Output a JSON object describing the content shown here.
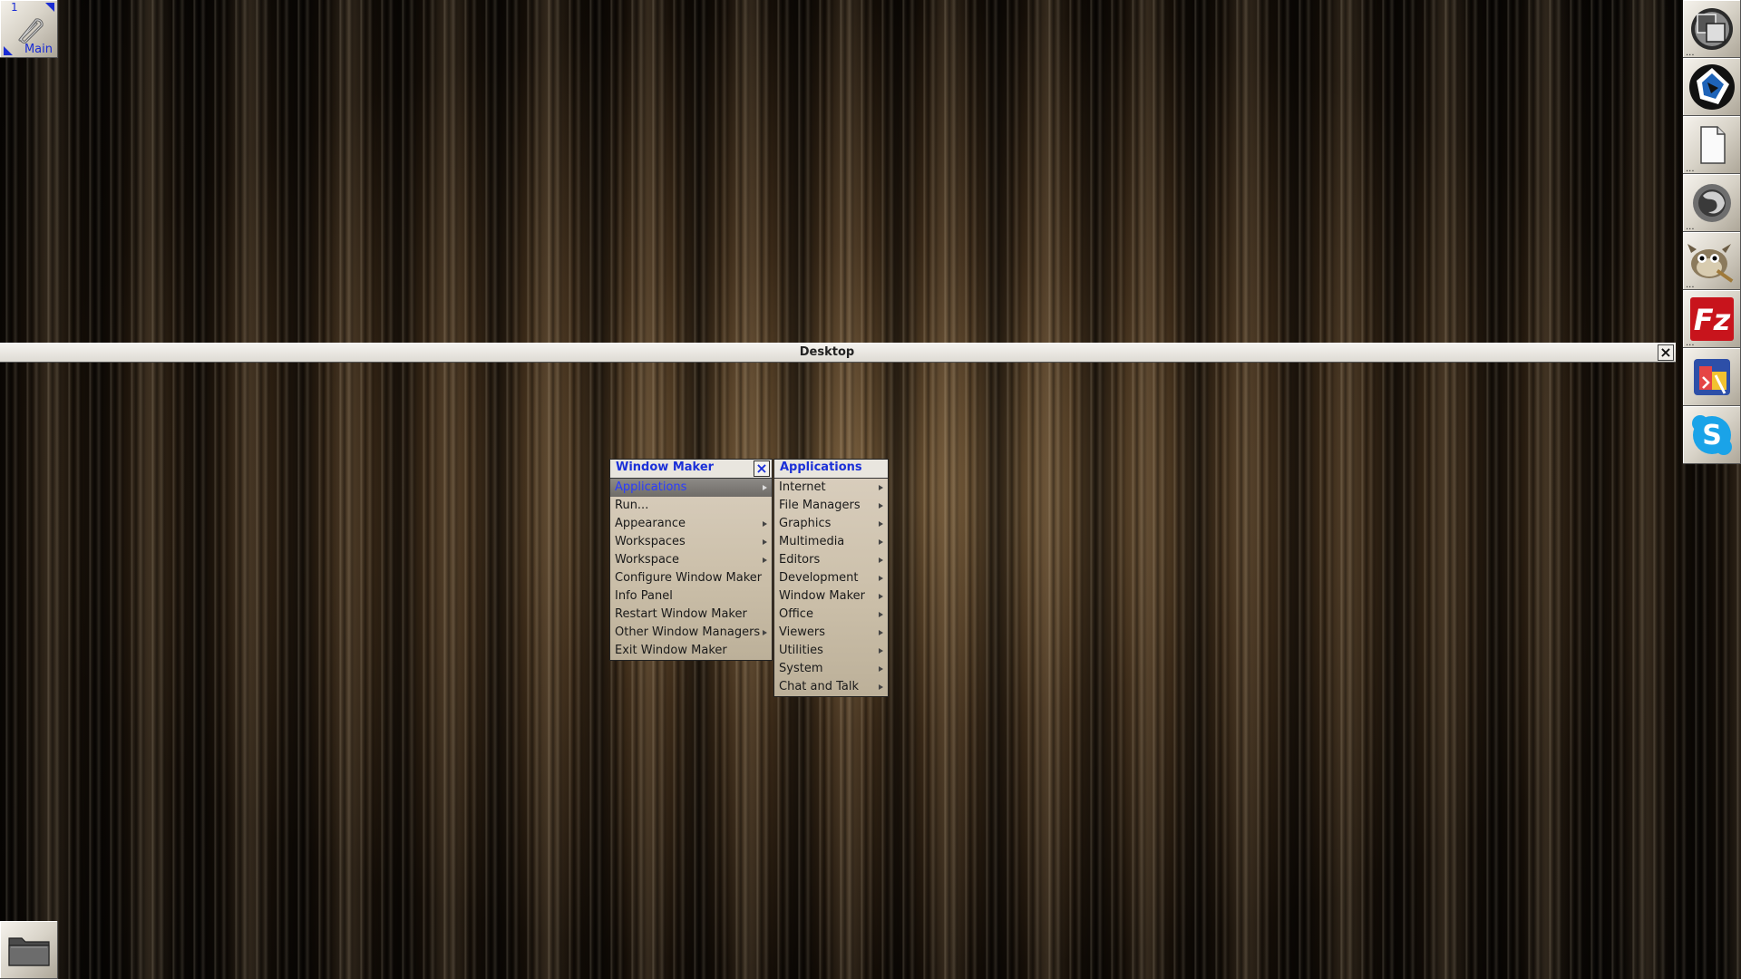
{
  "clip": {
    "workspace_number": "1",
    "workspace_name": "Main"
  },
  "desktop_window": {
    "title": "Desktop"
  },
  "root_menu": {
    "title": "Window Maker",
    "items": [
      {
        "label": "Applications",
        "submenu": true,
        "selected": true
      },
      {
        "label": "Run...",
        "submenu": false
      },
      {
        "label": "Appearance",
        "submenu": true
      },
      {
        "label": "Workspaces",
        "submenu": true
      },
      {
        "label": "Workspace",
        "submenu": true
      },
      {
        "label": "Configure Window Maker",
        "submenu": false
      },
      {
        "label": "Info Panel",
        "submenu": false
      },
      {
        "label": "Restart Window Maker",
        "submenu": false
      },
      {
        "label": "Other Window Managers",
        "submenu": true
      },
      {
        "label": "Exit Window Maker",
        "submenu": false
      }
    ]
  },
  "applications_menu": {
    "title": "Applications",
    "items": [
      {
        "label": "Internet"
      },
      {
        "label": "File Managers"
      },
      {
        "label": "Graphics"
      },
      {
        "label": "Multimedia"
      },
      {
        "label": "Editors"
      },
      {
        "label": "Development"
      },
      {
        "label": "Window Maker"
      },
      {
        "label": "Office"
      },
      {
        "label": "Viewers"
      },
      {
        "label": "Utilities"
      },
      {
        "label": "System"
      },
      {
        "label": "Chat and Talk"
      }
    ]
  },
  "dock": {
    "tiles": [
      {
        "icon": "window-maker-icon"
      },
      {
        "icon": "gnustep-icon"
      },
      {
        "icon": "text-editor-icon"
      },
      {
        "icon": "firefox-icon"
      },
      {
        "icon": "gimp-icon"
      },
      {
        "icon": "filezilla-icon"
      },
      {
        "icon": "code-editor-icon"
      },
      {
        "icon": "skype-icon"
      }
    ],
    "dots": "..."
  },
  "colors": {
    "accent_blue": "#1b30d8",
    "selected_text": "#2a3cff"
  }
}
